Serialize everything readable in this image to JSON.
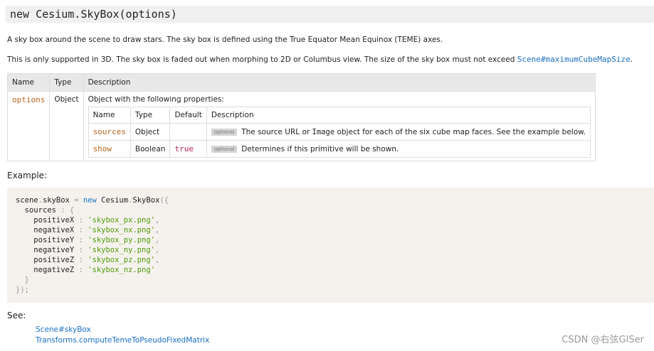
{
  "signature": "new Cesium.SkyBox(options)",
  "description_line1": "A sky box around the scene to draw stars. The sky box is defined using the True Equator Mean Equinox (TEME) axes.",
  "description_line2": "This is only supported in 3D. The sky box is faded out when morphing to 2D or Columbus view. The size of the sky box must not exceed ",
  "description_link": "Scene#maximumCubeMapSize",
  "description_end": ".",
  "params_table": {
    "headers": [
      "Name",
      "Type",
      "Description"
    ],
    "row": {
      "name": "options",
      "type": "Object",
      "description": "Object with the following properties:"
    },
    "sub_headers": [
      "Name",
      "Type",
      "Default",
      "Description"
    ],
    "sub_rows": [
      {
        "name": "sources",
        "type": "Object",
        "default": "",
        "badge": "optional",
        "desc_before": "The source URL or ",
        "desc_code": "Image",
        "desc_after": " object for each of the six cube map faces. See the example below."
      },
      {
        "name": "show",
        "type": "Boolean",
        "default": "true",
        "badge": "optional",
        "desc_before": "Determines if this primitive will be shown.",
        "desc_code": "",
        "desc_after": ""
      }
    ]
  },
  "example_heading": "Example:",
  "code": {
    "line1": [
      "scene",
      ".",
      "skyBox",
      " = ",
      "new",
      " Cesium",
      ".",
      "SkyBox",
      "({"
    ],
    "sources_key": "sources",
    "colon": " : ",
    "open_brace": "{",
    "entries": [
      {
        "key": "positiveX",
        "value": "'skybox_px.png'",
        "comma": ","
      },
      {
        "key": "negativeX",
        "value": "'skybox_nx.png'",
        "comma": ","
      },
      {
        "key": "positiveY",
        "value": "'skybox_py.png'",
        "comma": ","
      },
      {
        "key": "negativeY",
        "value": "'skybox_ny.png'",
        "comma": ","
      },
      {
        "key": "positiveZ",
        "value": "'skybox_pz.png'",
        "comma": ","
      },
      {
        "key": "negativeZ",
        "value": "'skybox_nz.png'",
        "comma": ""
      }
    ],
    "close_inner": "}",
    "close_outer": "});"
  },
  "see_heading": "See:",
  "see_links": [
    "Scene#skyBox",
    "Transforms.computeTemeToPseudoFixedMatrix"
  ],
  "watermark": "CSDN @右弦GISer",
  "colors": {
    "link": "#1a6fc4",
    "param_name": "#b5651d",
    "string": "#4e9a06",
    "code_bg": "#f5f2ee"
  }
}
